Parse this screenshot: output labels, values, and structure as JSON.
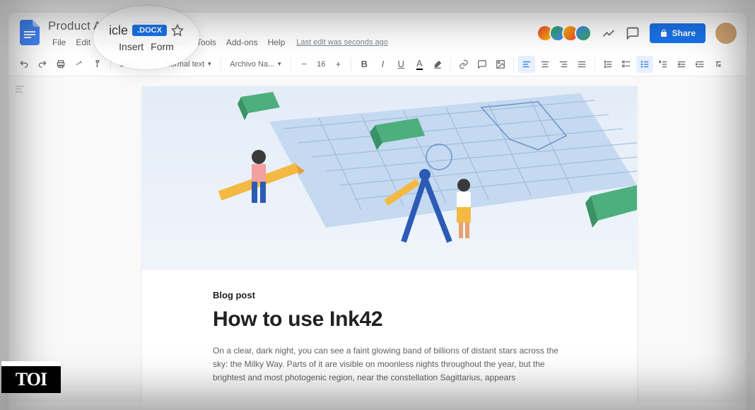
{
  "header": {
    "title": "Product Article",
    "badge": ".DOCX",
    "menu": [
      "File",
      "Edit",
      "View",
      "Insert",
      "Format",
      "Tools",
      "Add-ons",
      "Help"
    ],
    "last_edit": "Last edit was seconds ago",
    "share": "Share"
  },
  "zoom": {
    "title_suffix": "icle",
    "badge": ".DOCX",
    "menu": [
      "Insert",
      "Form"
    ]
  },
  "toolbar": {
    "style": "Normal text",
    "font": "Archivo Na...",
    "size": "16"
  },
  "document": {
    "label": "Blog post",
    "title": "How to use Ink42",
    "body": "On a clear, dark night, you can see a faint glowing band of billions of distant stars across the sky: the Milky Way. Parts of it are visible on moonless nights throughout the year, but the brightest and most photogenic region, near the constellation Sagittarius, appears"
  },
  "toi": "TOI"
}
